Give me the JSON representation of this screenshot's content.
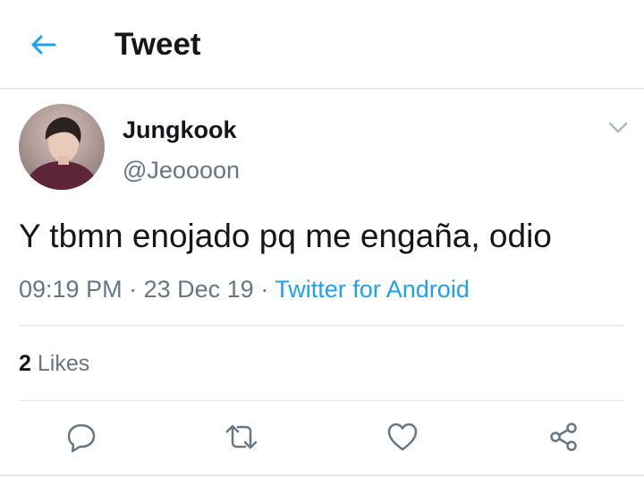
{
  "header": {
    "title": "Tweet",
    "back_icon": "arrow-left-icon"
  },
  "tweet": {
    "user": {
      "name": "Jungkook",
      "handle": "@Jeoooon"
    },
    "text": "Y tbmn enojado pq me engaña, odio",
    "time": "09:19 PM",
    "date": "23 Dec 19",
    "source": "Twitter for Android",
    "separator": "·",
    "likes": {
      "count": "2",
      "label": "Likes"
    }
  },
  "actions": [
    {
      "icon": "reply-icon"
    },
    {
      "icon": "retweet-icon"
    },
    {
      "icon": "like-icon"
    },
    {
      "icon": "share-icon"
    }
  ],
  "colors": {
    "accent": "#1da1f2",
    "text_primary": "#14171a",
    "text_secondary": "#657786",
    "divider": "#e1e8ed"
  }
}
